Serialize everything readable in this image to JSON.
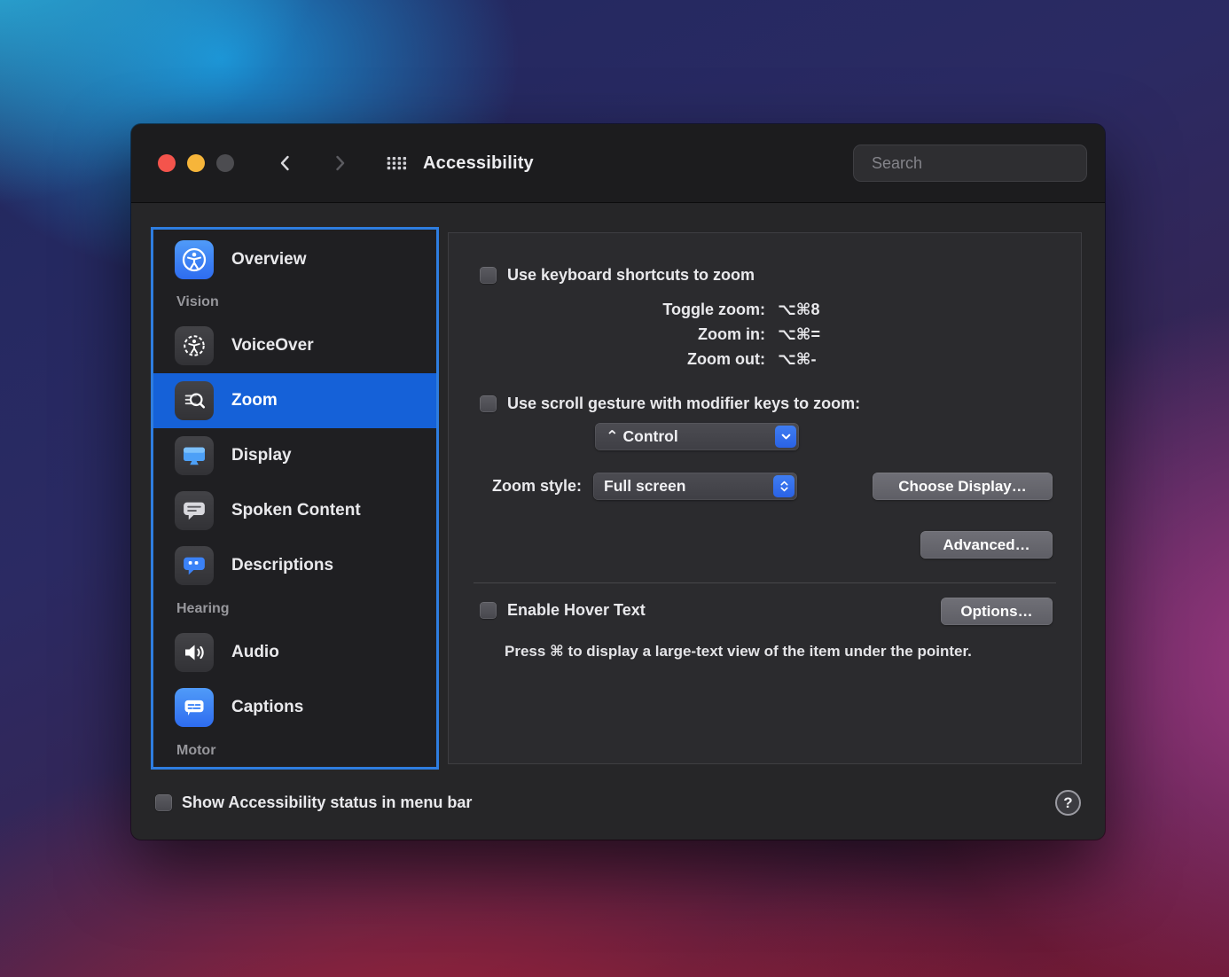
{
  "window": {
    "title": "Accessibility",
    "search": {
      "placeholder": "Search"
    }
  },
  "sidebar": {
    "items": [
      {
        "type": "item",
        "label": "Overview",
        "icon": "accessibility-overview-icon",
        "selected": false
      },
      {
        "type": "section",
        "label": "Vision"
      },
      {
        "type": "item",
        "label": "VoiceOver",
        "icon": "voiceover-icon",
        "selected": false
      },
      {
        "type": "item",
        "label": "Zoom",
        "icon": "zoom-icon",
        "selected": true
      },
      {
        "type": "item",
        "label": "Display",
        "icon": "display-icon",
        "selected": false
      },
      {
        "type": "item",
        "label": "Spoken Content",
        "icon": "spoken-content-icon",
        "selected": false
      },
      {
        "type": "item",
        "label": "Descriptions",
        "icon": "descriptions-icon",
        "selected": false
      },
      {
        "type": "section",
        "label": "Hearing"
      },
      {
        "type": "item",
        "label": "Audio",
        "icon": "audio-icon",
        "selected": false
      },
      {
        "type": "item",
        "label": "Captions",
        "icon": "captions-icon",
        "selected": false
      },
      {
        "type": "section",
        "label": "Motor"
      }
    ]
  },
  "content": {
    "keyboard_shortcuts_label": "Use keyboard shortcuts to zoom",
    "keyboard_shortcuts_checked": false,
    "shortcuts": [
      {
        "label": "Toggle zoom:",
        "keys": "⌥⌘8"
      },
      {
        "label": "Zoom in:",
        "keys": "⌥⌘="
      },
      {
        "label": "Zoom out:",
        "keys": "⌥⌘-"
      }
    ],
    "scroll_gesture_label": "Use scroll gesture with modifier keys to zoom:",
    "scroll_gesture_checked": false,
    "modifier_key_value": "⌃ Control",
    "zoom_style_label": "Zoom style:",
    "zoom_style_value": "Full screen",
    "choose_display_button": "Choose Display…",
    "advanced_button": "Advanced…",
    "hover_text_label": "Enable Hover Text",
    "hover_text_checked": false,
    "options_button": "Options…",
    "hover_text_hint": "Press ⌘ to display a large-text view of the item under the pointer."
  },
  "footer": {
    "status_label": "Show Accessibility status in menu bar",
    "status_checked": false,
    "help_label": "?"
  },
  "colors": {
    "accent_blue": "#1561d8",
    "focus_ring": "#2e7de0"
  }
}
